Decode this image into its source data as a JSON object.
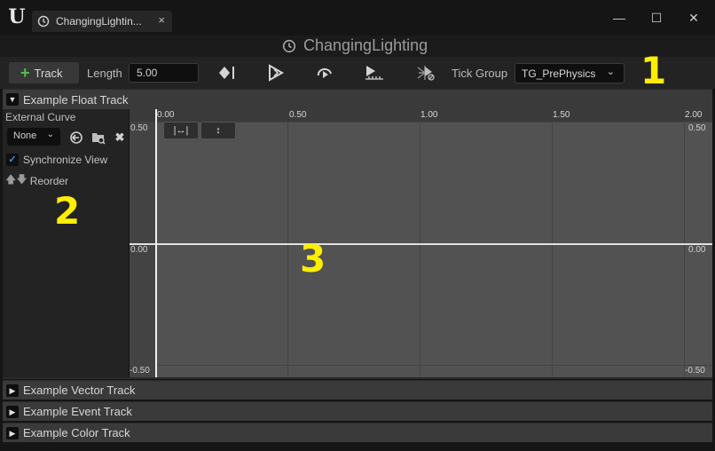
{
  "window": {
    "tab_label": "ChangingLightin...",
    "tab_close": "×",
    "minimize": "—",
    "maximize": "☐",
    "close": "✕"
  },
  "asset_title": "ChangingLighting",
  "toolbar": {
    "track_plus": "+",
    "track_label": "Track",
    "length_label": "Length",
    "length_value": "5.00",
    "tick_group_label": "Tick Group",
    "tick_group_value": "TG_PrePhysics",
    "icons": [
      "add-key-icon",
      "autoplay-icon",
      "loop-icon",
      "last-keyframe-icon",
      "replicated-icon"
    ]
  },
  "tracks": {
    "float_track": "Example Float Track",
    "vector_track": "Example Vector Track",
    "event_track": "Example Event Track",
    "color_track": "Example Color Track"
  },
  "details": {
    "external_curve_label": "External Curve",
    "curve_value": "None",
    "synchronize_view_label": "Synchronize View",
    "synchronize_checked": true,
    "reorder_label": "Reorder"
  },
  "graph": {
    "x_ticks": [
      "0.00",
      "0.50",
      "1.00",
      "1.50",
      "2.00"
    ],
    "y_top": "0.50",
    "y_mid": "0.00",
    "y_bottom": "-0.50",
    "fit_horizontal": "|↔|",
    "fit_vertical": "↕"
  },
  "callouts": [
    "1",
    "2",
    "3"
  ]
}
